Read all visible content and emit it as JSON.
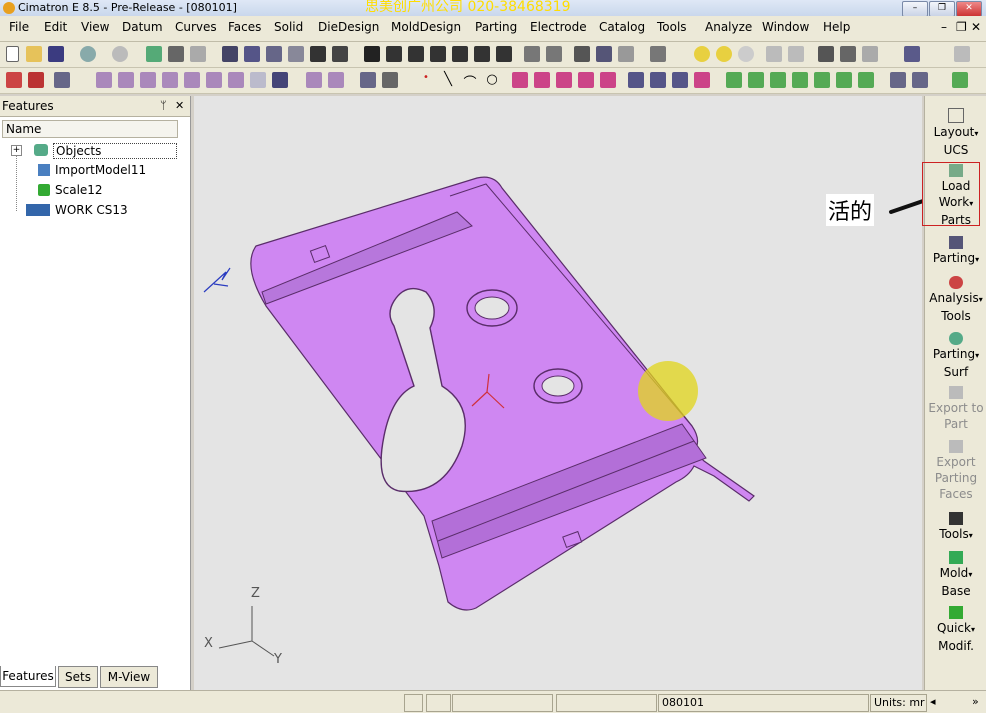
{
  "window": {
    "title": "Cimatron E 8.5 - Pre-Release - [080101]",
    "watermark": "思美创广州公司 020-38468319",
    "min_label": "–",
    "max_label": "❐",
    "close_label": "✕"
  },
  "menu": [
    "File",
    "Edit",
    "View",
    "Datum",
    "Curves",
    "Faces",
    "Solid",
    "DieDesign",
    "MoldDesign",
    "Parting",
    "Electrode",
    "Catalog",
    "Tools",
    "Analyze",
    "Window",
    "Help"
  ],
  "menu_right": {
    "minimize": "–",
    "restore": "❐",
    "close": "✕"
  },
  "features_panel": {
    "title": "Features",
    "pin": "ᛘ",
    "close": "✕",
    "column": "Name",
    "tree": [
      {
        "label": "Objects",
        "expander": "+"
      },
      {
        "label": "ImportModel11"
      },
      {
        "label": "Scale12"
      },
      {
        "label": "WORK CS13"
      }
    ],
    "tabs": [
      "Features",
      "Sets",
      "M-View"
    ]
  },
  "viewport": {
    "annotation": "活的",
    "axis": {
      "z": "Z",
      "x": "X",
      "y": "Y"
    }
  },
  "rightbar": [
    {
      "label": "Layout",
      "sub": "UCS",
      "arrow": "▾",
      "disabled": false
    },
    {
      "label": "Load",
      "sub": "Work",
      "sub2": "Parts",
      "arrow": "▾",
      "disabled": false
    },
    {
      "label": "Parting",
      "arrow": "▾",
      "disabled": false
    },
    {
      "label": "Analysis",
      "sub": "Tools",
      "arrow": "▾",
      "disabled": false
    },
    {
      "label": "Parting",
      "sub": "Surf",
      "arrow": "▾",
      "disabled": false
    },
    {
      "label": "Export to",
      "sub": "Part",
      "disabled": true
    },
    {
      "label": "Export",
      "sub": "Parting",
      "sub2": "Faces",
      "disabled": true
    },
    {
      "label": "Tools",
      "arrow": "▾",
      "disabled": false
    },
    {
      "label": "Mold",
      "sub": "Base",
      "arrow": "▾",
      "disabled": false
    },
    {
      "label": "Quick",
      "sub": "Modif.",
      "arrow": "▾",
      "disabled": false
    }
  ],
  "status": {
    "file": "080101",
    "units": "Units: mr",
    "arrow_left": "◂",
    "arrow_right": "»"
  },
  "colors": {
    "part": "#cf87f2",
    "part_edge": "#5a2d6a",
    "highlight": "#e2d51a",
    "annotation_box": "#cc2222"
  }
}
